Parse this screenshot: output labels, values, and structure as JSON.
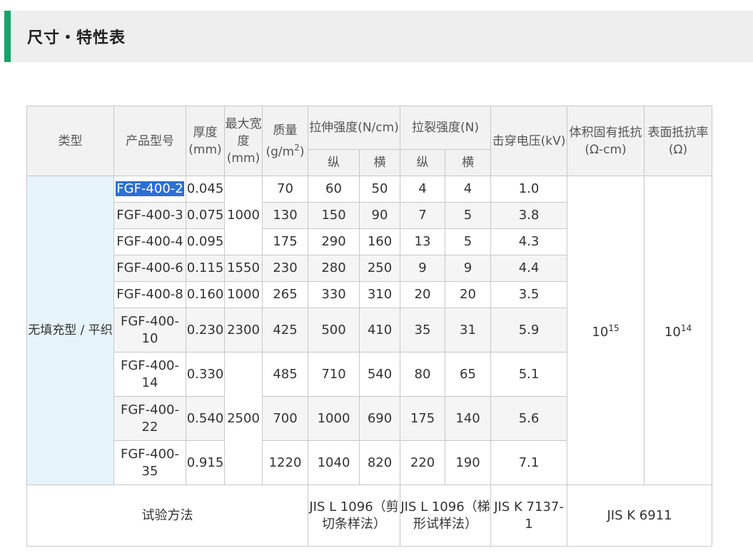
{
  "section": {
    "title": "尺寸・特性表",
    "accent_color": "#1aa36a"
  },
  "table": {
    "headers": {
      "type": "类型",
      "model": "产品型号",
      "thickness": "厚度(mm)",
      "width": "最大宽度(mm)",
      "mass": "质量(g/m",
      "mass_sup": "2",
      "mass_end": ")",
      "tensile": "拉伸强度(N/cm)",
      "tear": "拉裂强度(N)",
      "long": "纵",
      "trans": "横",
      "breakdown": "击穿电压(kV)",
      "volume_res": "体积固有抵抗(Ω-cm)",
      "surface_res": "表面抵抗率(Ω)"
    },
    "category": "无填充型 / 平织",
    "volume_res_base": "10",
    "volume_res_exp": "15",
    "surface_res_base": "10",
    "surface_res_exp": "14",
    "width_values": [
      "1000",
      "1550",
      "1000",
      "2300",
      "2500"
    ],
    "rows": [
      {
        "model": "FGF-400-2",
        "thickness": "0.045",
        "mass": "70",
        "tensile_l": "60",
        "tensile_t": "50",
        "tear_l": "4",
        "tear_t": "4",
        "kv": "1.0",
        "selected": true
      },
      {
        "model": "FGF-400-3",
        "thickness": "0.075",
        "mass": "130",
        "tensile_l": "150",
        "tensile_t": "90",
        "tear_l": "7",
        "tear_t": "5",
        "kv": "3.8"
      },
      {
        "model": "FGF-400-4",
        "thickness": "0.095",
        "mass": "175",
        "tensile_l": "290",
        "tensile_t": "160",
        "tear_l": "13",
        "tear_t": "5",
        "kv": "4.3"
      },
      {
        "model": "FGF-400-6",
        "thickness": "0.115",
        "mass": "230",
        "tensile_l": "280",
        "tensile_t": "250",
        "tear_l": "9",
        "tear_t": "9",
        "kv": "4.4"
      },
      {
        "model": "FGF-400-8",
        "thickness": "0.160",
        "mass": "265",
        "tensile_l": "330",
        "tensile_t": "310",
        "tear_l": "20",
        "tear_t": "20",
        "kv": "3.5"
      },
      {
        "model": "FGF-400-10",
        "thickness": "0.230",
        "mass": "425",
        "tensile_l": "500",
        "tensile_t": "410",
        "tear_l": "35",
        "tear_t": "31",
        "kv": "5.9"
      },
      {
        "model": "FGF-400-14",
        "thickness": "0.330",
        "mass": "485",
        "tensile_l": "710",
        "tensile_t": "540",
        "tear_l": "80",
        "tear_t": "65",
        "kv": "5.1"
      },
      {
        "model": "FGF-400-22",
        "thickness": "0.540",
        "mass": "700",
        "tensile_l": "1000",
        "tensile_t": "690",
        "tear_l": "175",
        "tear_t": "140",
        "kv": "5.6"
      },
      {
        "model": "FGF-400-35",
        "thickness": "0.915",
        "mass": "1220",
        "tensile_l": "1040",
        "tensile_t": "820",
        "tear_l": "220",
        "tear_t": "190",
        "kv": "7.1"
      }
    ],
    "footer": {
      "label": "试验方法",
      "tensile": "JIS L 1096（剪切条样法）",
      "tear": "JIS L 1096（梯形试样法）",
      "kv": "JIS K 7137-1",
      "res": "JIS K 6911"
    }
  }
}
